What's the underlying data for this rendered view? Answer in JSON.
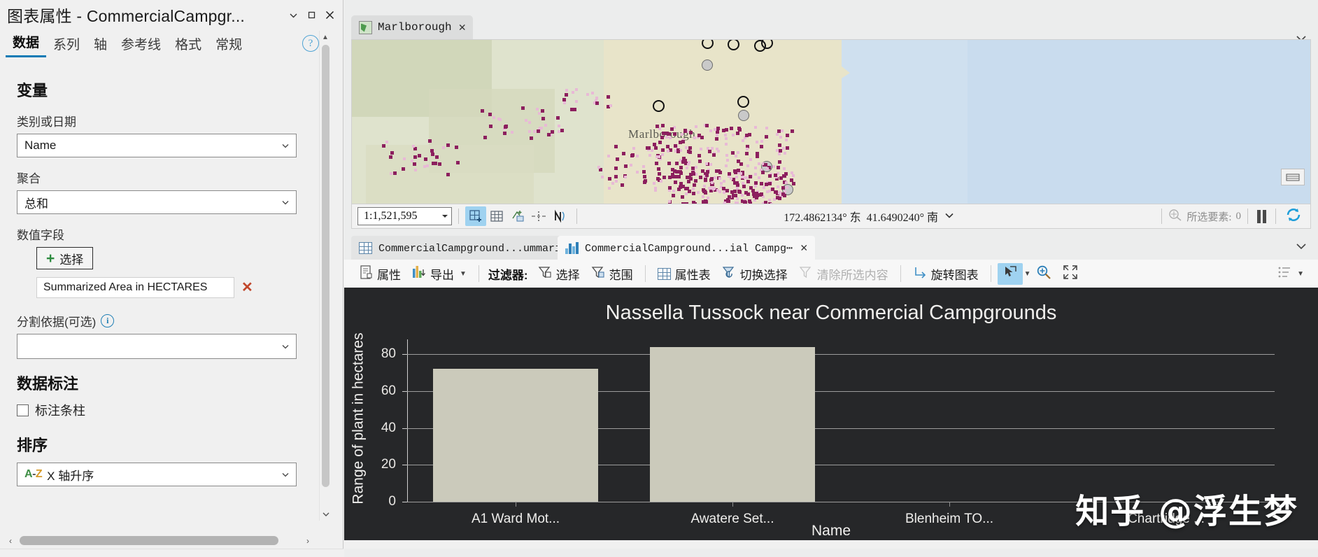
{
  "panel": {
    "title": "图表属性 - CommercialCampgr...",
    "ghost_title": "Nassella Tussock near Commercial...",
    "window_buttons": {
      "minimize": "chevron-down",
      "maximize": "square",
      "close": "times"
    },
    "tabs": [
      {
        "label": "数据",
        "active": true
      },
      {
        "label": "系列",
        "active": false
      },
      {
        "label": "轴",
        "active": false
      },
      {
        "label": "参考线",
        "active": false
      },
      {
        "label": "格式",
        "active": false
      },
      {
        "label": "常规",
        "active": false
      }
    ],
    "help_label": "?",
    "sections": {
      "variable_heading": "变量",
      "category_label": "类别或日期",
      "category_value": "Name",
      "aggregation_label": "聚合",
      "aggregation_value": "总和",
      "numeric_field_label": "数值字段",
      "select_button": "选择",
      "numeric_field_chip": "Summarized Area in HECTARES",
      "split_by_label": "分割依据(可选)",
      "split_by_value": "",
      "data_label_heading": "数据标注",
      "label_bars_checkbox": "标注条柱",
      "label_bars_checked": false,
      "sort_heading": "排序",
      "sort_value": "X 轴升序",
      "sort_icon_text": "A-Z"
    }
  },
  "map": {
    "tab_label": "Marlborough",
    "place_label": "Marlborough",
    "status": {
      "scale": "1:1,521,595",
      "longitude": "172.4862134° 东",
      "latitude": "41.6490240° 南",
      "selected_features_label": "所选要素:",
      "selected_features_count": "0"
    },
    "tools": [
      {
        "name": "add-data-tool",
        "active": true
      },
      {
        "name": "grid-tool",
        "active": false
      },
      {
        "name": "select-by-area-tool",
        "active": false
      },
      {
        "name": "measure-tool",
        "active": false
      },
      {
        "name": "north-arrow-tool",
        "active": false
      }
    ]
  },
  "view_tabs": [
    {
      "label": "CommercialCampground...ummarizeW⋯",
      "icon": "table-icon",
      "active": false,
      "closable": false
    },
    {
      "label": "CommercialCampground...ial Campg⋯",
      "icon": "bar-chart-icon",
      "active": true,
      "closable": true
    }
  ],
  "chart_toolbar": {
    "properties": "属性",
    "export": "导出",
    "filter_label": "过滤器:",
    "filter_selection": "选择",
    "filter_extent": "范围",
    "attribute_table": "属性表",
    "switch_selection": "切换选择",
    "clear_selection": "清除所选内容",
    "rotate_chart": "旋转图表",
    "select_tool_active": true
  },
  "chart_data": {
    "type": "bar",
    "title": "Nassella Tussock near Commercial Campgrounds",
    "xlabel": "Name",
    "ylabel": "Range of plant in hectares",
    "categories": [
      "A1 Ward Mot...",
      "Awatere Set...",
      "Blenheim TO...",
      "Chartridge ..."
    ],
    "values": [
      72,
      84,
      0,
      0
    ],
    "yticks": [
      0,
      20,
      40,
      60,
      80
    ],
    "ylim": [
      0,
      88
    ],
    "grid": true,
    "legend": "none",
    "bar_color": "#cbcabb",
    "background": "#262729",
    "text_color": "#f0efed"
  },
  "watermark": "知乎 @浮生梦"
}
